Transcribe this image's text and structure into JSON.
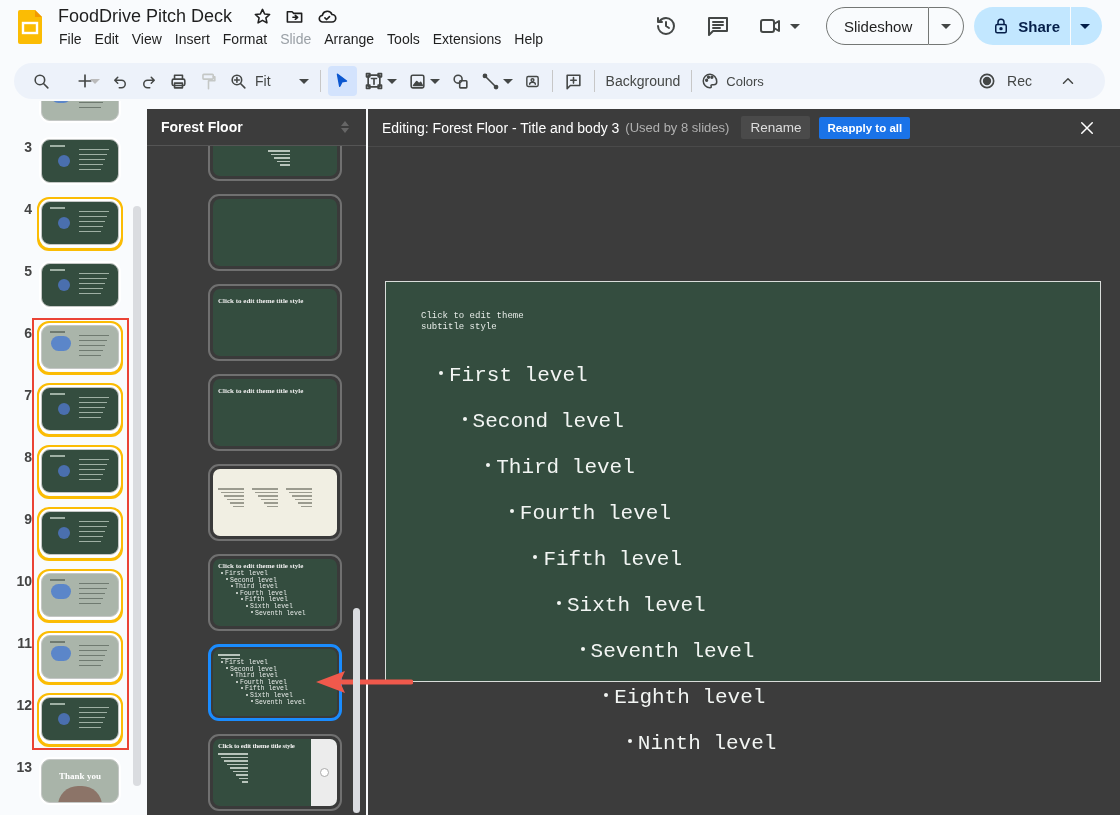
{
  "document": {
    "title": "FoodDrive Pitch Deck"
  },
  "menu": [
    {
      "label": "File",
      "disabled": false
    },
    {
      "label": "Edit",
      "disabled": false
    },
    {
      "label": "View",
      "disabled": false
    },
    {
      "label": "Insert",
      "disabled": false
    },
    {
      "label": "Format",
      "disabled": false
    },
    {
      "label": "Slide",
      "disabled": true
    },
    {
      "label": "Arrange",
      "disabled": false
    },
    {
      "label": "Tools",
      "disabled": false
    },
    {
      "label": "Extensions",
      "disabled": false
    },
    {
      "label": "Help",
      "disabled": false
    }
  ],
  "header": {
    "slideshow": "Slideshow",
    "share": "Share"
  },
  "toolbar": {
    "zoom": "Fit",
    "background": "Background",
    "colors": "Colors",
    "record": "Rec",
    "select_tool": {
      "selected": true
    },
    "paint_format": {
      "disabled": true
    }
  },
  "filmstrip": {
    "slides": [
      {
        "kind": "light",
        "selected": false,
        "highlighted": false
      },
      {
        "number": "3",
        "kind": "dark",
        "selected": false,
        "highlighted": false
      },
      {
        "number": "4",
        "kind": "dark",
        "selected": true,
        "highlighted": false
      },
      {
        "number": "5",
        "kind": "dark",
        "selected": false,
        "highlighted": false
      },
      {
        "number": "6",
        "kind": "light",
        "selected": true,
        "highlighted": true
      },
      {
        "number": "7",
        "kind": "dark",
        "selected": true,
        "highlighted": true
      },
      {
        "number": "8",
        "kind": "dark",
        "selected": true,
        "highlighted": true
      },
      {
        "number": "9",
        "kind": "dark",
        "selected": true,
        "highlighted": true
      },
      {
        "number": "10",
        "kind": "light",
        "selected": true,
        "highlighted": true
      },
      {
        "number": "11",
        "kind": "light",
        "selected": true,
        "highlighted": true
      },
      {
        "number": "12",
        "kind": "dark",
        "selected": true,
        "highlighted": true
      },
      {
        "number": "13",
        "kind": "closing",
        "title": "Thank you",
        "selected": false,
        "highlighted": false
      }
    ]
  },
  "layouts_panel": {
    "theme": "Forest Floor",
    "layouts": [
      {
        "kind": "centered-body",
        "selected": false,
        "pointed_at": false
      },
      {
        "kind": "blank",
        "selected": false,
        "pointed_at": false
      },
      {
        "kind": "title-only",
        "title": "Click to edit theme title style",
        "selected": false,
        "pointed_at": false
      },
      {
        "kind": "title-only",
        "title": "Click to edit theme title style",
        "selected": false,
        "pointed_at": false
      },
      {
        "kind": "three-columns",
        "selected": false,
        "pointed_at": false
      },
      {
        "kind": "title-body",
        "title": "Click to edit theme title style",
        "bullets": [
          {
            "text": "First level",
            "children": [
              {
                "text": "Second level",
                "children": [
                  {
                    "text": "Third level",
                    "children": [
                      {
                        "text": "Fourth level",
                        "children": [
                          {
                            "text": "Fifth level",
                            "children": [
                              {
                                "text": "Sixth level",
                                "children": [
                                  {
                                    "text": "Seventh level"
                                  }
                                ]
                              }
                            ]
                          }
                        ]
                      }
                    ]
                  }
                ]
              }
            ]
          }
        ],
        "selected": false,
        "pointed_at": false
      },
      {
        "kind": "subtitle-body",
        "bullets": [
          {
            "text": "First level",
            "children": [
              {
                "text": "Second level",
                "children": [
                  {
                    "text": "Third level",
                    "children": [
                      {
                        "text": "Fourth level",
                        "children": [
                          {
                            "text": "Fifth level",
                            "children": [
                              {
                                "text": "Sixth level",
                                "children": [
                                  {
                                    "text": "Seventh level"
                                  }
                                ]
                              }
                            ]
                          }
                        ]
                      }
                    ]
                  }
                ]
              }
            ]
          }
        ],
        "selected": true,
        "pointed_at": true
      },
      {
        "kind": "title-body-image",
        "title": "Click to edit theme title style",
        "selected": false,
        "pointed_at": false
      }
    ]
  },
  "editor": {
    "heading": "Editing: Forest Floor - Title and body 3",
    "usage": "(Used by 8 slides)",
    "rename": "Rename",
    "reapply": "Reapply to all",
    "slide": {
      "subtitle": "Click to edit theme subtitle style",
      "bullets": [
        {
          "text": "First level",
          "children": [
            {
              "text": "Second level",
              "children": [
                {
                  "text": "Third level",
                  "children": [
                    {
                      "text": "Fourth level",
                      "children": [
                        {
                          "text": "Fifth level",
                          "children": [
                            {
                              "text": "Sixth level",
                              "children": [
                                {
                                  "text": "Seventh level",
                                  "children": [
                                    {
                                      "text": "Eighth level",
                                      "children": [
                                        {
                                          "text": "Ninth level"
                                        }
                                      ]
                                    }
                                  ]
                                }
                              ]
                            }
                          ]
                        }
                      ]
                    }
                  ]
                }
              ]
            }
          ]
        }
      ]
    }
  }
}
